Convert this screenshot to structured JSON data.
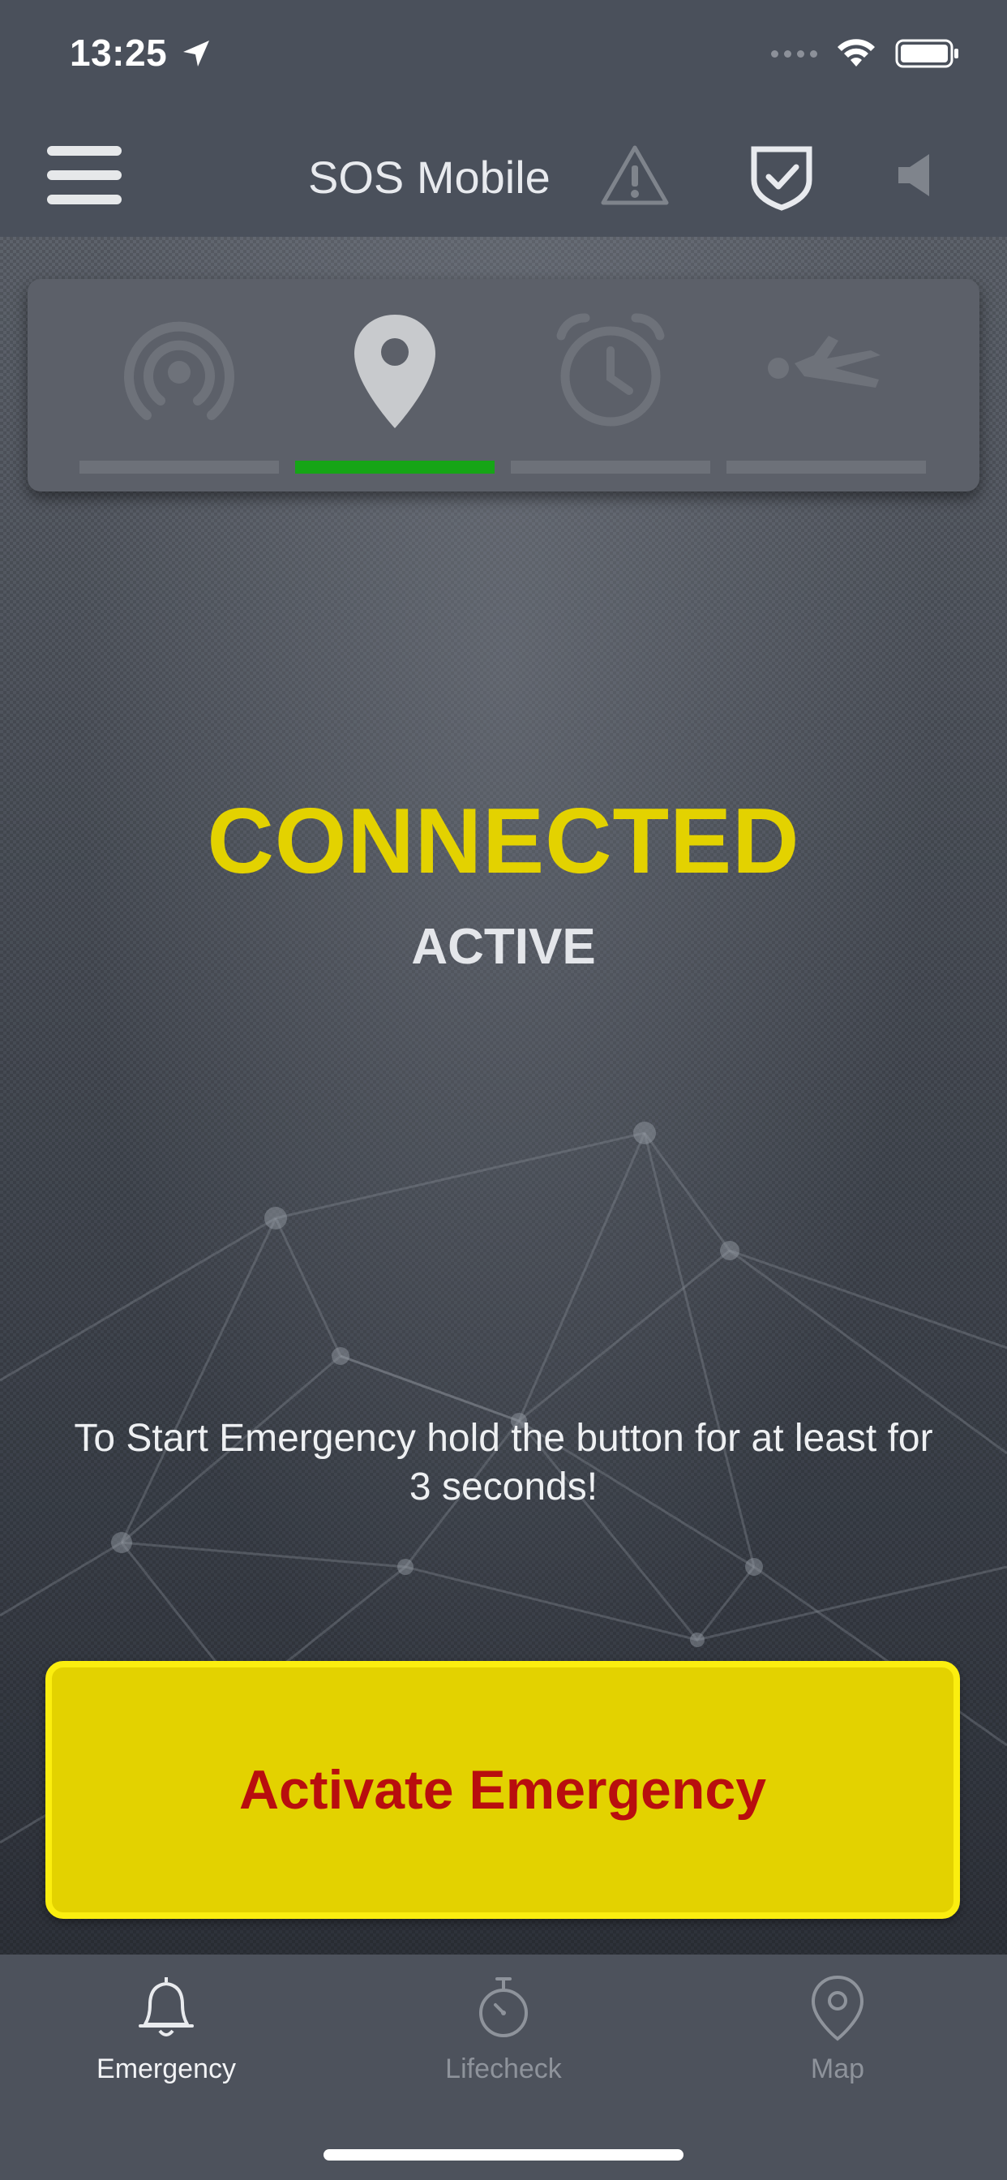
{
  "status_bar": {
    "time": "13:25"
  },
  "nav": {
    "title": "SOS Mobile",
    "icons": [
      "menu-icon",
      "warning-icon",
      "shield-check-icon",
      "speaker-icon"
    ]
  },
  "indicators": [
    {
      "icon": "broadcast-icon",
      "active": false
    },
    {
      "icon": "location-pin-icon",
      "active": true
    },
    {
      "icon": "alarm-clock-icon",
      "active": false
    },
    {
      "icon": "man-down-icon",
      "active": false
    }
  ],
  "connection": {
    "title": "CONNECTED",
    "subtitle": "ACTIVE"
  },
  "hint": "To Start Emergency hold the button for at least for 3 seconds!",
  "activate_button": {
    "label": "Activate Emergency"
  },
  "tabs": [
    {
      "label": "Emergency",
      "icon": "bell-icon",
      "active": true
    },
    {
      "label": "Lifecheck",
      "icon": "stopwatch-icon",
      "active": false
    },
    {
      "label": "Map",
      "icon": "map-pin-icon",
      "active": false
    }
  ],
  "colors": {
    "accent_yellow": "#e3d200",
    "danger_red": "#b80e0e",
    "active_green": "#16a516"
  }
}
